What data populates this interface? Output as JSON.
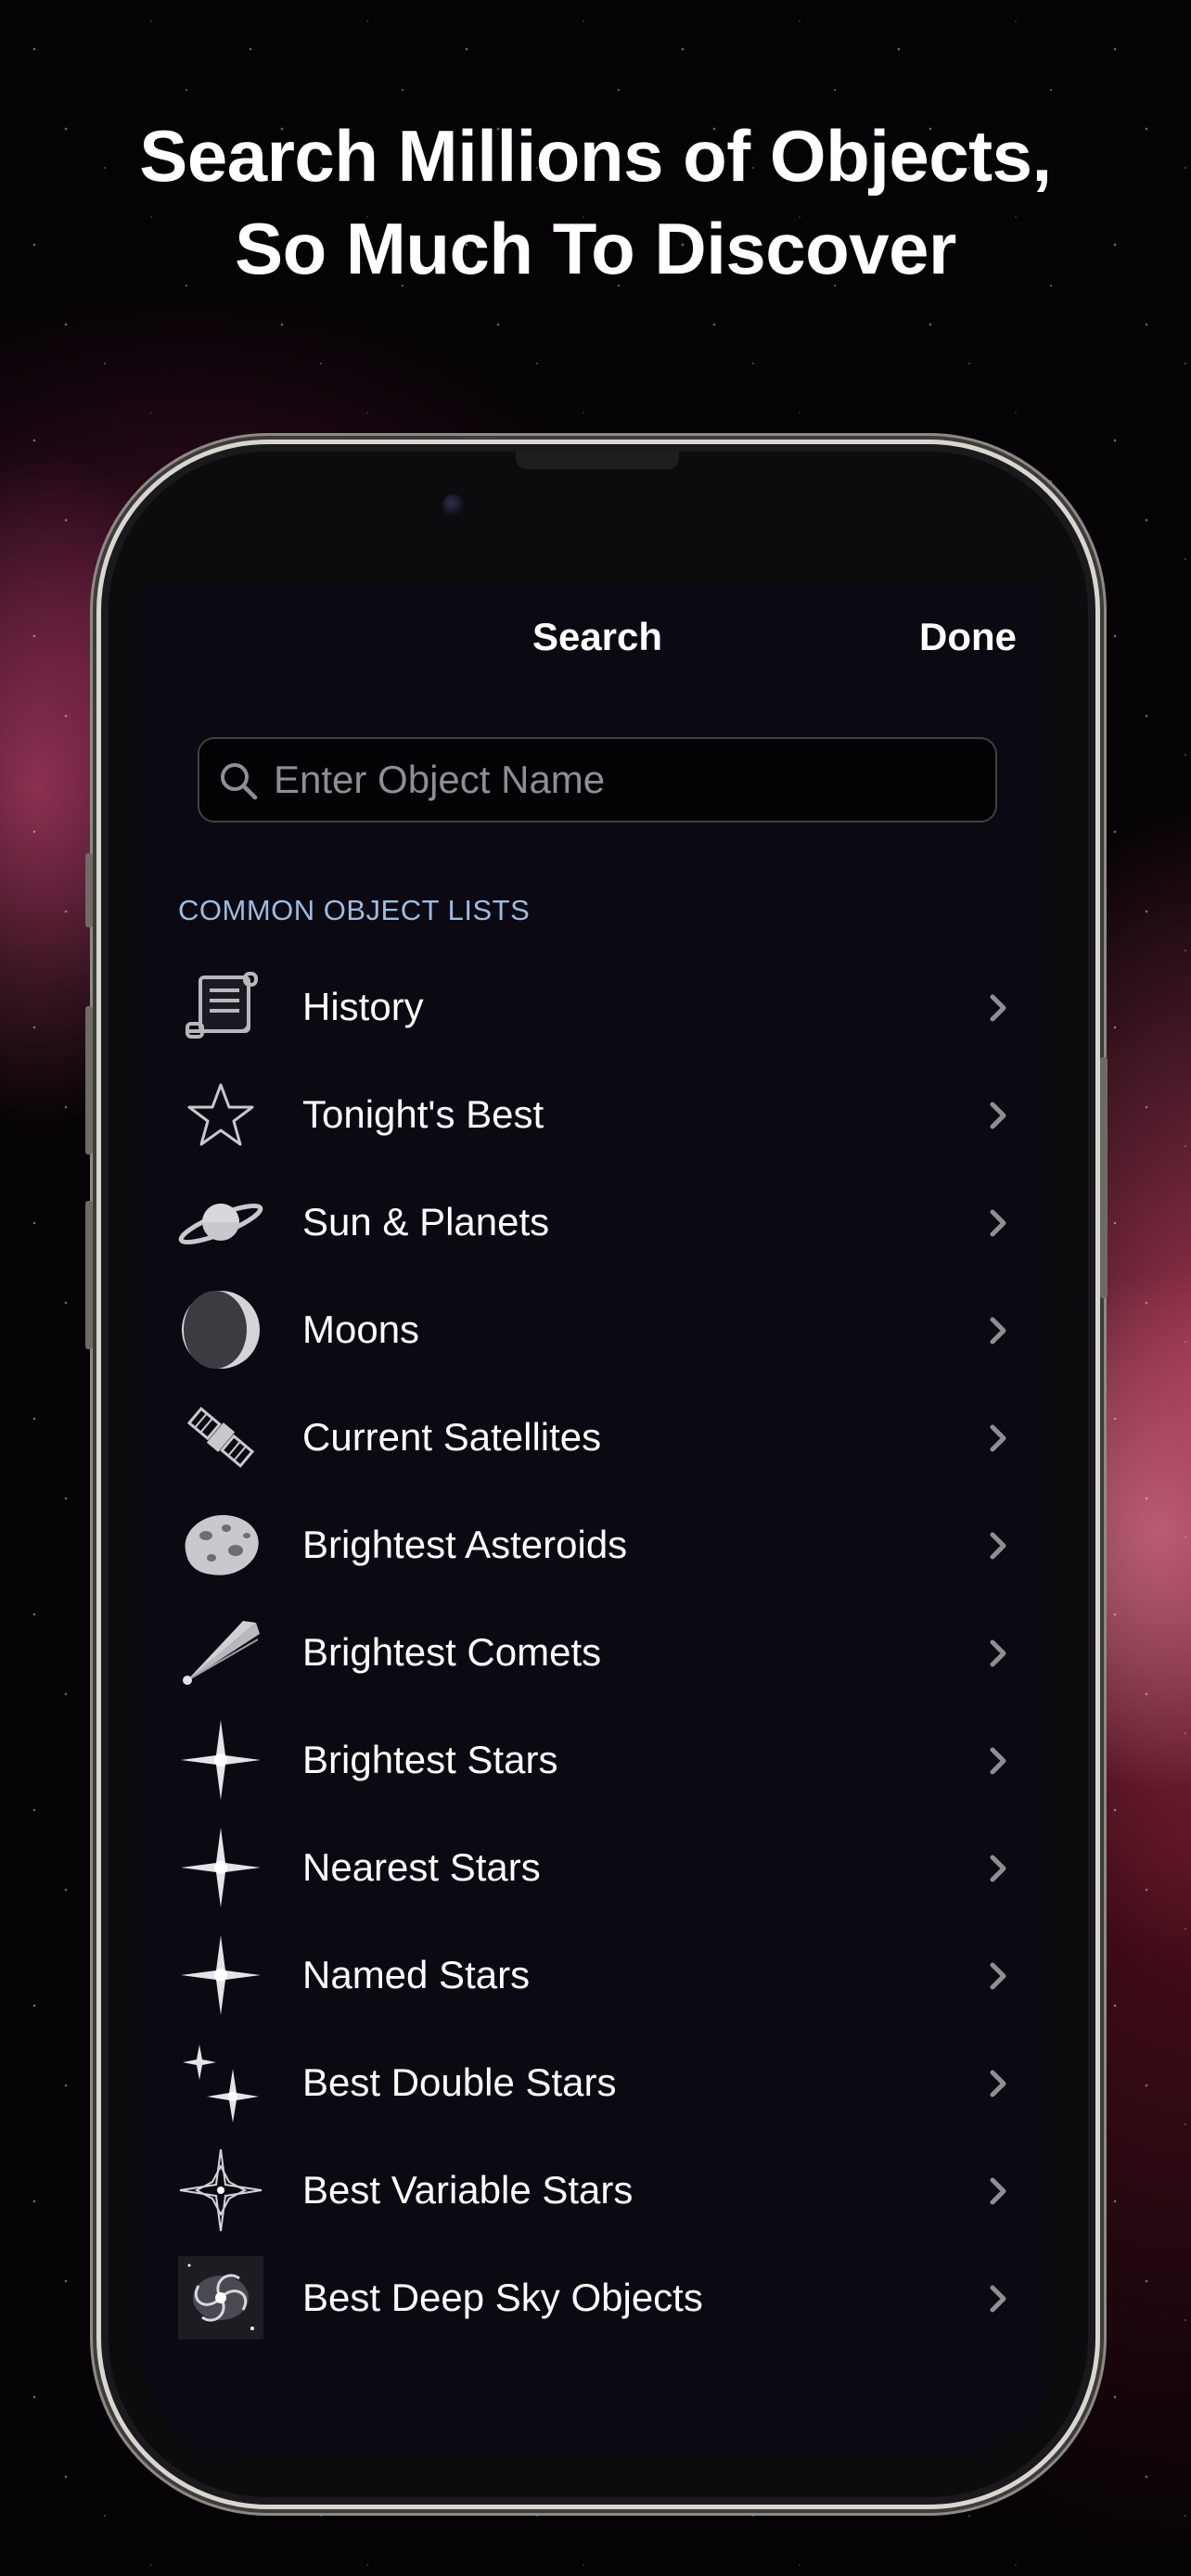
{
  "headline": {
    "line1": "Search Millions of Objects,",
    "line2": "So Much To Discover"
  },
  "navbar": {
    "title": "Search",
    "done_label": "Done"
  },
  "search": {
    "placeholder": "Enter Object Name",
    "value": ""
  },
  "section_header": "COMMON OBJECT LISTS",
  "items": [
    {
      "label": "History",
      "icon": "scroll-icon"
    },
    {
      "label": "Tonight's Best",
      "icon": "star-outline-icon"
    },
    {
      "label": "Sun & Planets",
      "icon": "planet-icon"
    },
    {
      "label": "Moons",
      "icon": "moon-icon"
    },
    {
      "label": "Current Satellites",
      "icon": "satellite-icon"
    },
    {
      "label": "Brightest Asteroids",
      "icon": "asteroid-icon"
    },
    {
      "label": "Brightest Comets",
      "icon": "comet-icon"
    },
    {
      "label": "Brightest Stars",
      "icon": "sparkle-star-icon"
    },
    {
      "label": "Nearest Stars",
      "icon": "sparkle-star-icon"
    },
    {
      "label": "Named Stars",
      "icon": "sparkle-star-icon"
    },
    {
      "label": "Best Double Stars",
      "icon": "double-star-icon"
    },
    {
      "label": "Best Variable Stars",
      "icon": "variable-star-icon"
    },
    {
      "label": "Best Deep Sky Objects",
      "icon": "galaxy-icon"
    }
  ],
  "colors": {
    "screen_background": "#0b0a12",
    "section_header": "#9fbbe0",
    "chevron": "#8e8e93",
    "text": "#ffffff"
  }
}
